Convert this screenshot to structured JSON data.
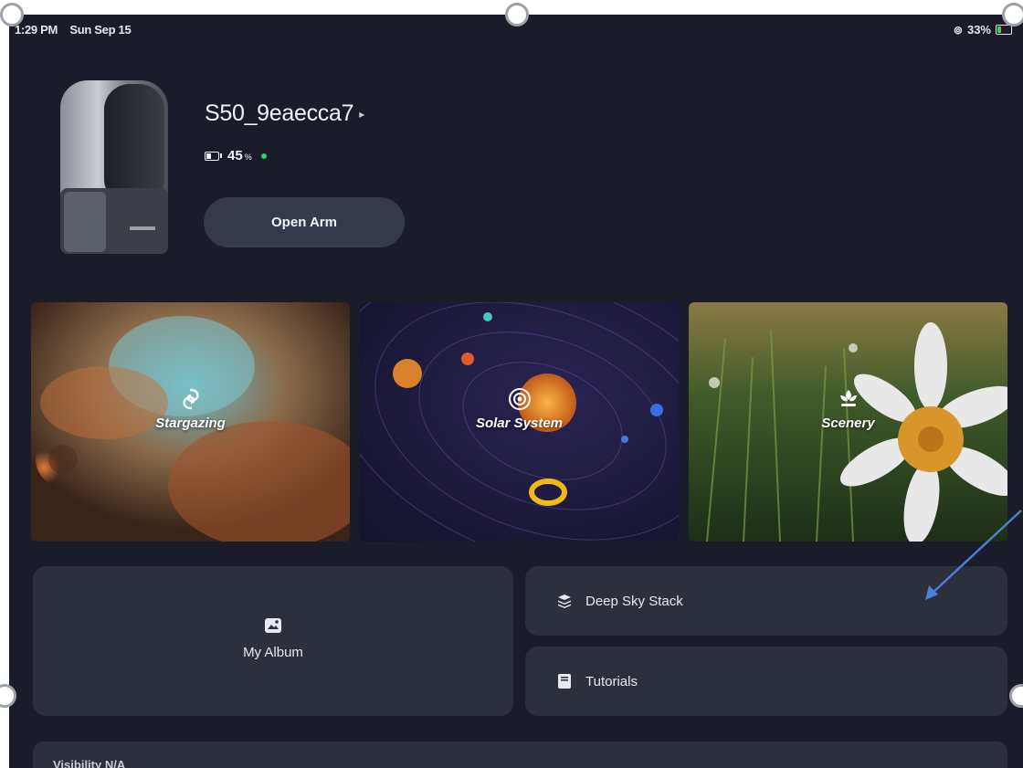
{
  "status_bar": {
    "time": "1:29 PM",
    "date": "Sun Sep 15",
    "battery_percent": "33%",
    "battery_level": 0.33
  },
  "device": {
    "name": "S50_9eaecca7",
    "battery_value": "45",
    "battery_unit": "%",
    "online": true,
    "open_arm_label": "Open Arm"
  },
  "modes": [
    {
      "label": "Stargazing",
      "icon": "galaxy-icon"
    },
    {
      "label": "Solar System",
      "icon": "orbit-icon"
    },
    {
      "label": "Scenery",
      "icon": "flower-icon"
    }
  ],
  "tiles": {
    "album": {
      "label": "My Album",
      "icon": "album-icon"
    },
    "deep_sky": {
      "label": "Deep Sky Stack",
      "icon": "stack-icon"
    },
    "tutorials": {
      "label": "Tutorials",
      "icon": "book-icon"
    }
  },
  "visibility": {
    "label": "Visibility N/A"
  },
  "colors": {
    "background": "#1a1d29",
    "tile": "#2c303d",
    "button": "#353a4b",
    "online": "#2fd06a",
    "annotation_arrow": "#4a7fd4"
  }
}
